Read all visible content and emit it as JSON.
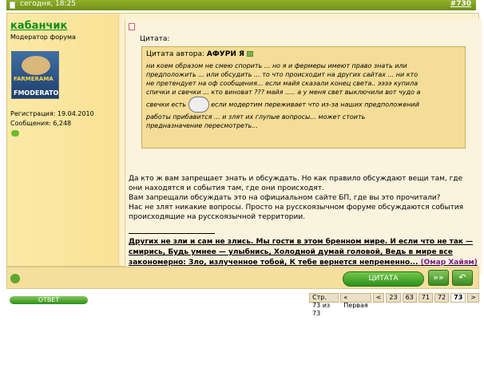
{
  "header": {
    "date": "сегодня, 18:25",
    "post_number": "#730"
  },
  "user": {
    "name": "кабанчик",
    "role": "Модератор форума",
    "avatar_text_top": "FARMERAMA",
    "avatar_text_bottom": "FMODERATOR",
    "registration": "Регистрация: 19.04.2010",
    "messages": "Сообщения: 6,248"
  },
  "quote": {
    "title": "Цитата:",
    "author_prefix": "Цитата автора: ",
    "author": "АФУРИ Я",
    "lines": [
      "ни коем образом не смею спорить ... но я и фермеры имеют право знать или",
      "предположить ... или обсудить ... то что происходит на других сайтах ... ни кто",
      "не претендует на оф сообщения... если майя сказали конец света.. ээээ купила",
      "спички и свечки ... кто виноват ??? майя ..... а у меня свет выключили вот чудо а",
      "свечки есть",
      "если модертим переживает что из-за наших предположений",
      "работы прибавится ... и злят их глупые вопросы... может стоить",
      "предназначение пересмотреть..."
    ]
  },
  "body": {
    "p1": "Да кто ж вам запрещает знать и обсуждать. Но как правило обсуждают вещи там, где они находятся и события там, где они происходят.",
    "p2": "Вам запрещали обсуждать это на официальном сайте БП, где вы это прочитали?",
    "p3": "Нас не злят никакие вопросы. Просто на русскоязычном форуме обсуждаются события происходящие на русскоязычной территории."
  },
  "signature": {
    "text": "Других не зли и сам не злись. Мы гости в этом бренном мире. И если что не так — смирись, Будь умнее — улыбнись, Холодной думай головой, Ведь в мире все закономерно: Зло, излученное тобой, К тебе вернется непременно...",
    "author": "(Омар Хайям)"
  },
  "footer": {
    "quote_button": "ЦИТАТА",
    "multi_quote_icon": "»»",
    "reply_icon": "↶"
  },
  "bottom": {
    "reply_button": "ОТВЕТ",
    "pager": [
      "Стр. 73 из 73",
      "« Первая",
      "<",
      "23",
      "63",
      "71",
      "72",
      "73",
      ">"
    ]
  }
}
